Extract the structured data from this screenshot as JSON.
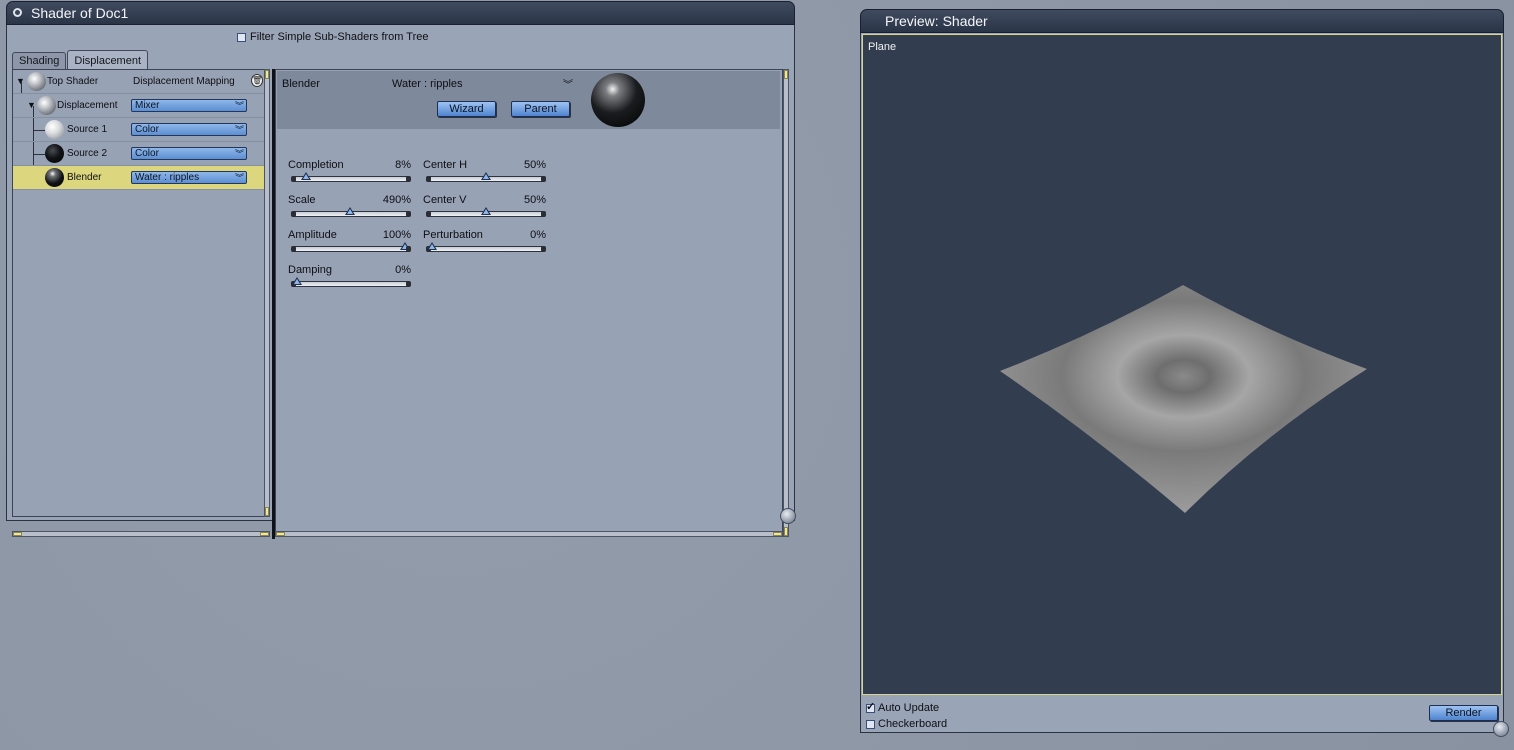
{
  "shader_window": {
    "title": "Shader of Doc1",
    "filter_label": "Filter Simple Sub-Shaders from Tree",
    "filter_checked": false,
    "tabs": [
      {
        "label": "Shading",
        "active": false
      },
      {
        "label": "Displacement",
        "active": true
      }
    ],
    "tree": {
      "top_shader": {
        "label": "Top Shader",
        "value": "Displacement Mapping"
      },
      "displacement": {
        "label": "Displacement",
        "value": "Mixer"
      },
      "source1": {
        "label": "Source 1",
        "value": "Color"
      },
      "source2": {
        "label": "Source 2",
        "value": "Color"
      },
      "blender": {
        "label": "Blender",
        "value": "Water : ripples",
        "selected": true
      }
    },
    "params": {
      "header_name": "Blender",
      "header_value": "Water : ripples",
      "wizard_label": "Wizard",
      "parent_label": "Parent",
      "completion": {
        "label": "Completion",
        "value": "8%",
        "fraction": 0.08
      },
      "center_h": {
        "label": "Center H",
        "value": "50%",
        "fraction": 0.5
      },
      "scale": {
        "label": "Scale",
        "value": "490%",
        "fraction": 0.49
      },
      "center_v": {
        "label": "Center V",
        "value": "50%",
        "fraction": 0.5
      },
      "amplitude": {
        "label": "Amplitude",
        "value": "100%",
        "fraction": 1.0
      },
      "perturbation": {
        "label": "Perturbation",
        "value": "0%",
        "fraction": 0.0
      },
      "damping": {
        "label": "Damping",
        "value": "0%",
        "fraction": 0.0
      }
    }
  },
  "preview_window": {
    "title": "Preview: Shader",
    "object_label": "Plane",
    "auto_update_label": "Auto Update",
    "auto_update_checked": true,
    "checkerboard_label": "Checkerboard",
    "checkerboard_checked": false,
    "render_label": "Render"
  },
  "colors": {
    "desktop": "#8e98a7",
    "panel": "#9aa4b7",
    "selected_row": "#dcd67e",
    "viewport": "#323d4f",
    "button": "#5c8ed1"
  },
  "icons": [
    "close-dot-icon",
    "trash-icon",
    "expand-triangle-icon",
    "chevron-down-icon",
    "checkbox-icon"
  ]
}
